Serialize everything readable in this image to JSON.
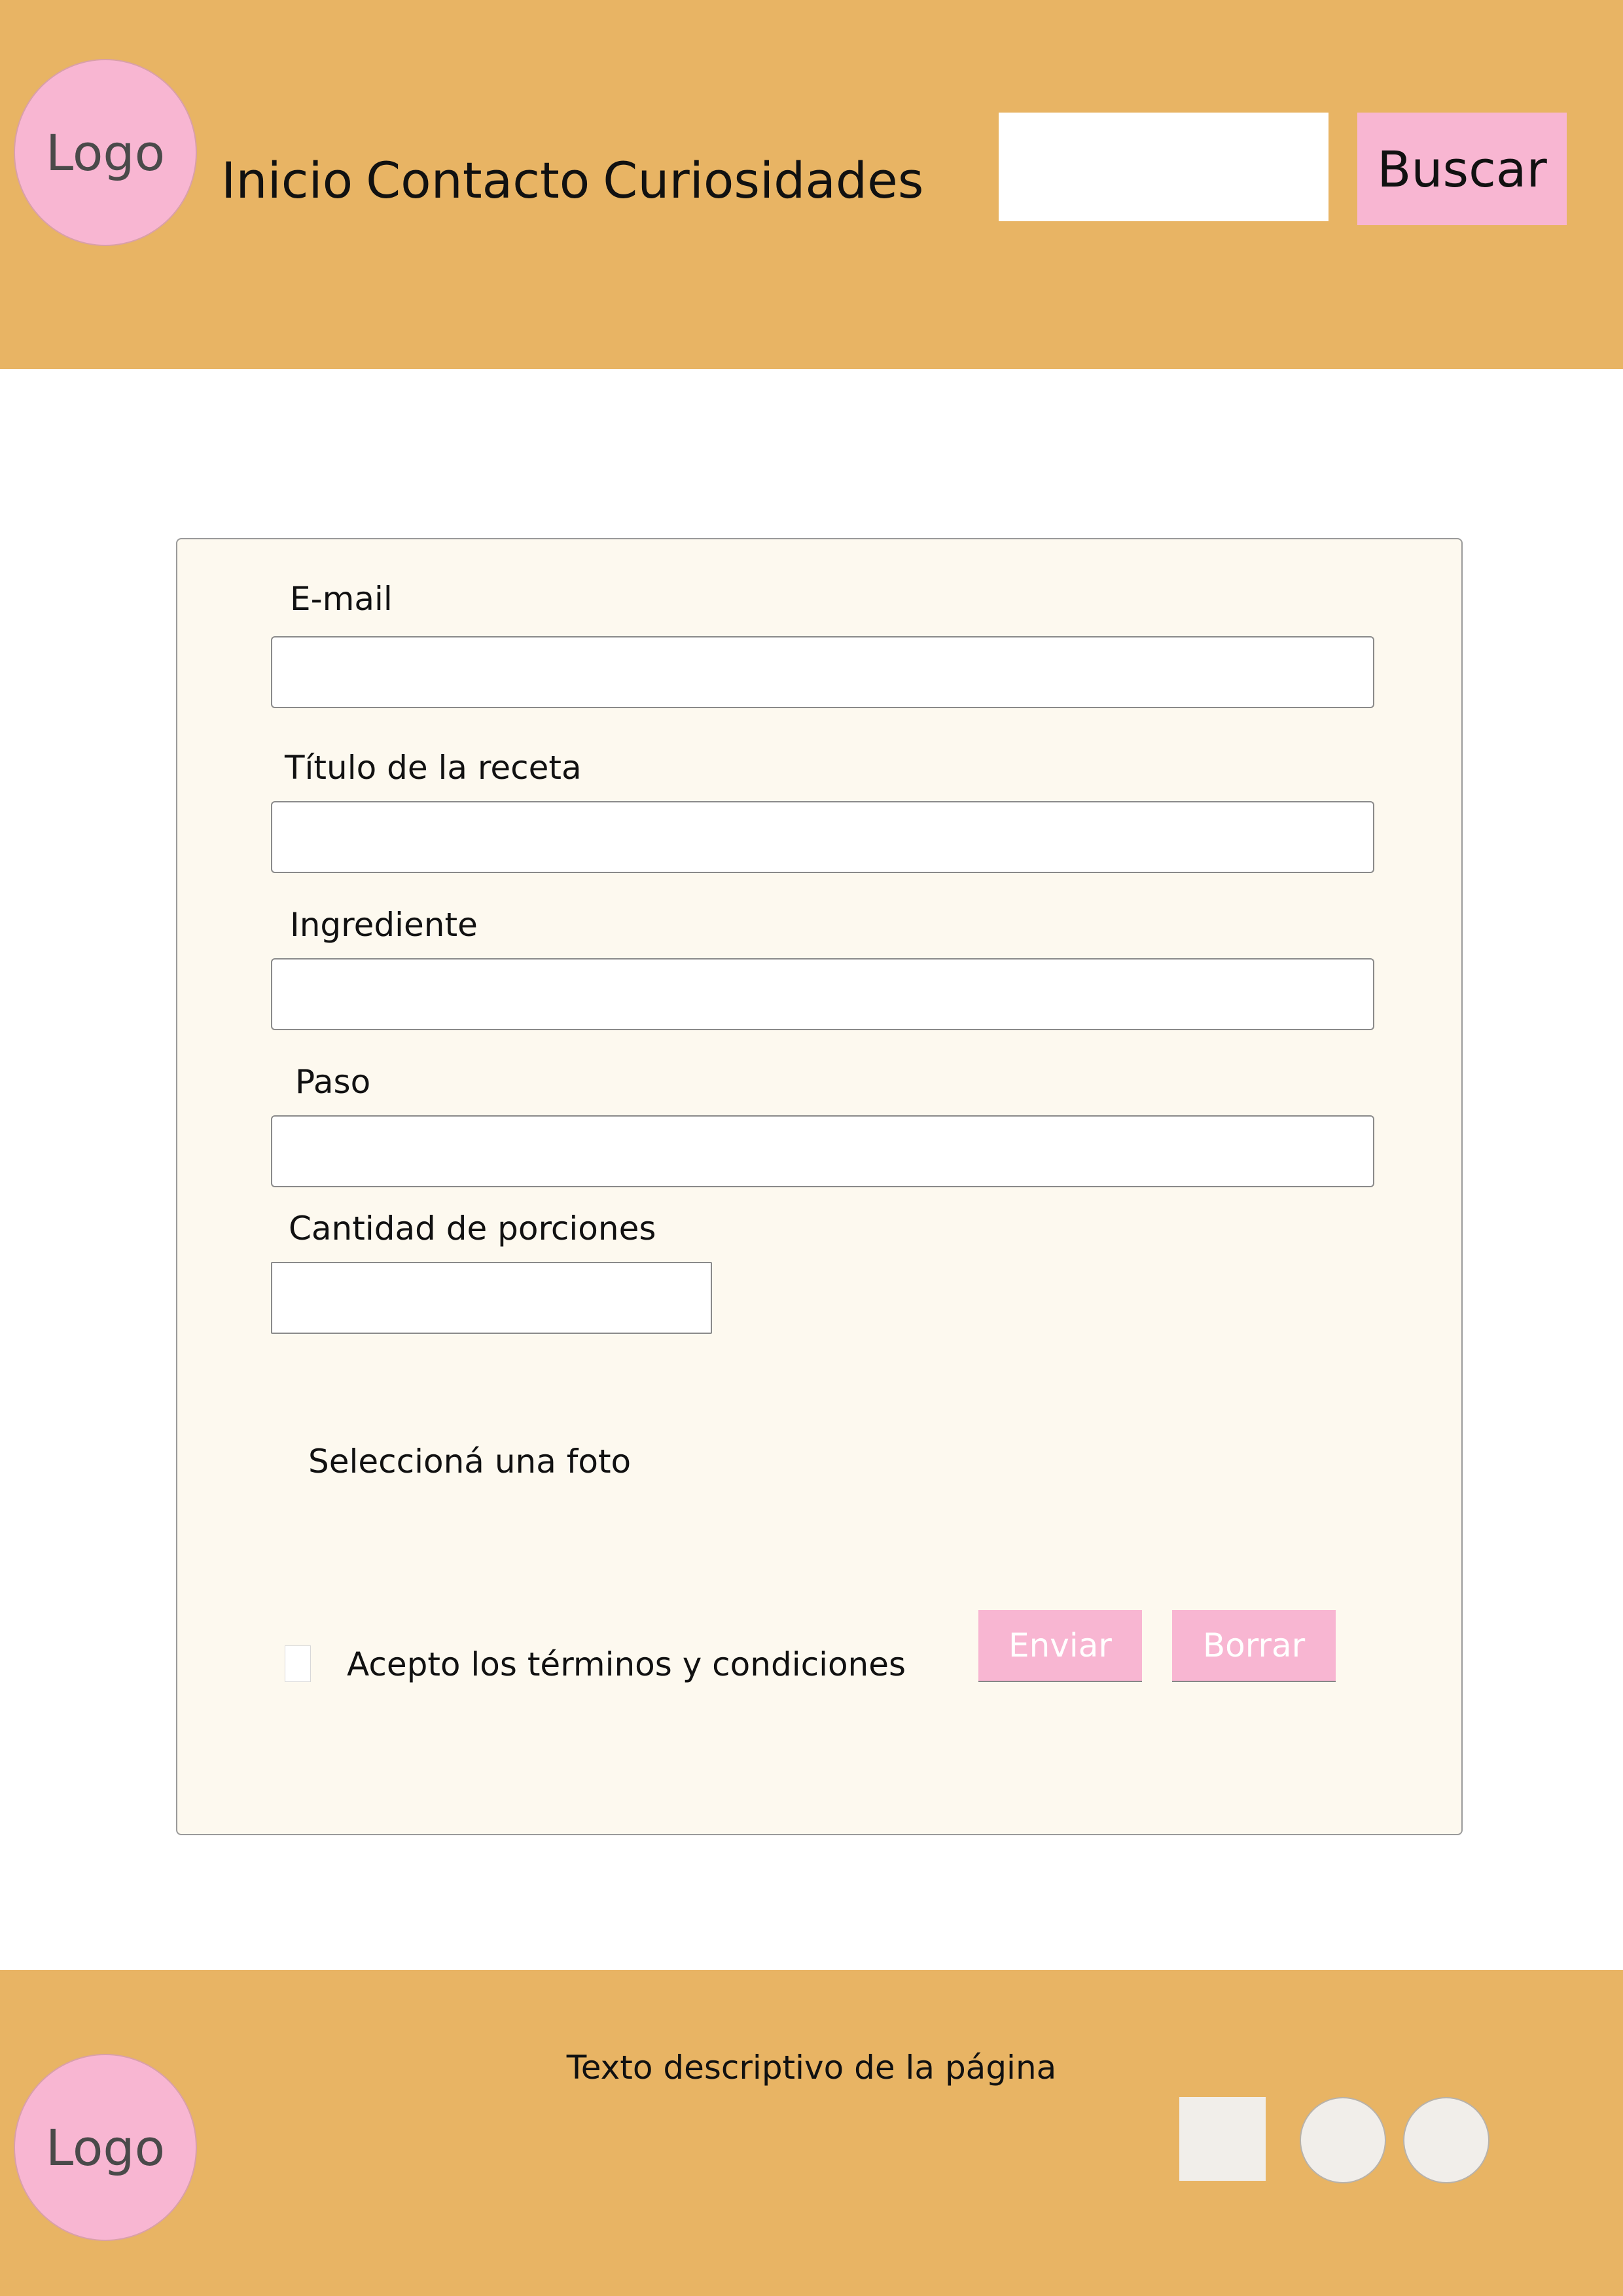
{
  "header": {
    "logo_text": "Logo",
    "nav": [
      "Inicio",
      "Contacto",
      "Curiosidades"
    ],
    "search": {
      "value": "",
      "placeholder": ""
    },
    "search_button_label": "Buscar"
  },
  "form": {
    "email_label": "E-mail",
    "email_value": "",
    "title_label": "Título de la receta",
    "title_value": "",
    "ingredient_label": "Ingrediente",
    "ingredient_value": "",
    "step_label": "Paso",
    "step_value": "",
    "servings_label": "Cantidad de porciones",
    "servings_value": "",
    "photo_label": "Seleccioná una foto",
    "terms_label": "Acepto los términos y condiciones",
    "terms_checked": false,
    "submit_label": "Enviar",
    "reset_label": "Borrar"
  },
  "footer": {
    "logo_text": "Logo",
    "description": "Texto descriptivo de la página",
    "social_icons": [
      "social-square-icon",
      "social-circle-icon",
      "social-circle-icon"
    ]
  },
  "colors": {
    "header_bg": "#e8b464",
    "accent_pink": "#f8b6d2",
    "card_bg": "#fdf9ef"
  }
}
